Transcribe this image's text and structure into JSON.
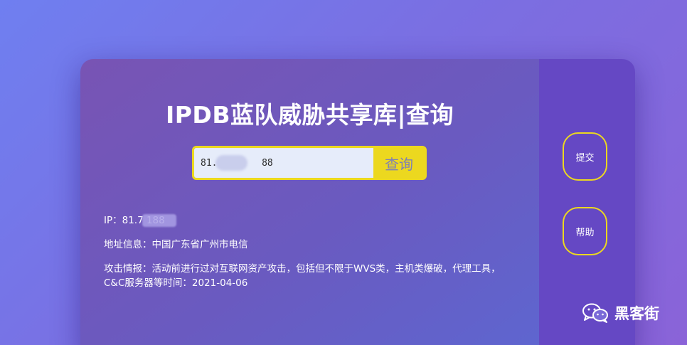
{
  "page": {
    "title": "IPDB蓝队威胁共享库|查询"
  },
  "search": {
    "value": "81.        88",
    "button_label": "查询"
  },
  "result": {
    "ip_line": "IP：81.7         188",
    "address_line": "地址信息：中国广东省广州市电信",
    "intel_line": "攻击情报：活动前进行过对互联网资产攻击，包括但不限于WVS类，主机类爆破，代理工具，C&C服务器等时间：2021-04-06"
  },
  "sidebar": {
    "submit_label": "提交",
    "help_label": "帮助"
  },
  "watermark": {
    "text": "黑客街",
    "icon": "wechat-icon"
  },
  "colors": {
    "accent_yellow": "#ecd81f",
    "side_panel": "#6548c4",
    "input_bg": "#e6ecfa"
  }
}
